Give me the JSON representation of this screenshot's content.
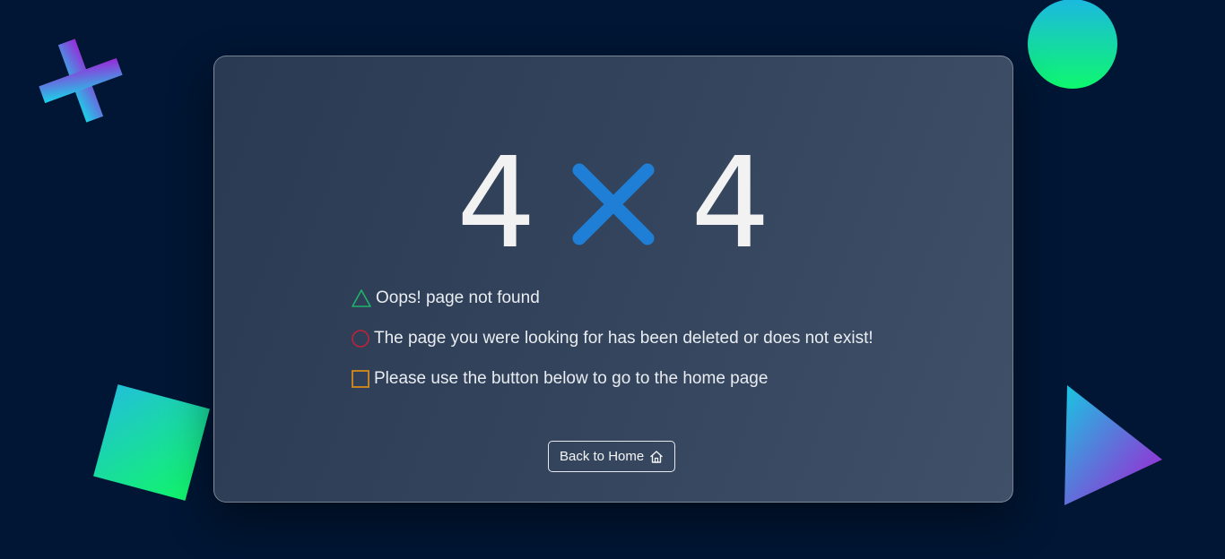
{
  "error_code": {
    "left_digit": "4",
    "right_digit": "4",
    "middle_icon": "x-mark-icon",
    "middle_color": "#1f7fd6"
  },
  "messages": [
    {
      "icon": "triangle-outline-icon",
      "icon_color": "#1fb36a",
      "text": "Oops! page not found"
    },
    {
      "icon": "circle-outline-icon",
      "icon_color": "#c0223a",
      "text": "The page you were looking for has been deleted or does not exist!"
    },
    {
      "icon": "square-outline-icon",
      "icon_color": "#d48a1c",
      "text": "Please use the button below to go to the home page"
    }
  ],
  "home_button": {
    "label": "Back to Home",
    "icon": "home-icon"
  },
  "decorations": {
    "shapes": [
      "plus-shape",
      "circle-shape",
      "square-shape",
      "triangle-shape"
    ]
  }
}
